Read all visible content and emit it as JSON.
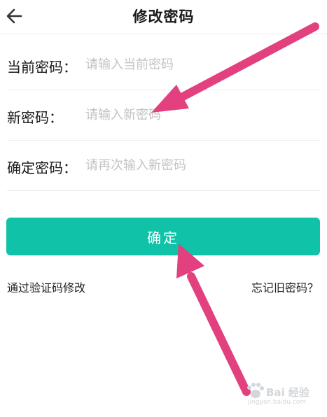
{
  "header": {
    "title": "修改密码",
    "back_icon": "back-arrow-icon"
  },
  "form": {
    "current_password": {
      "label": "当前密码：",
      "placeholder": "请输入当前密码",
      "value": ""
    },
    "new_password": {
      "label": "新密码：",
      "placeholder": "请输入新密码",
      "value": ""
    },
    "confirm_password": {
      "label": "确定密码：",
      "placeholder": "请再次输入新密码",
      "value": ""
    }
  },
  "actions": {
    "confirm_label": "确定",
    "verify_code_link": "通过验证码修改",
    "forgot_link": "忘记旧密码？"
  },
  "watermark": {
    "brand": "Bai 经验",
    "sub": "jingyan.baidu.com"
  },
  "colors": {
    "accent": "#10c2a8",
    "annotation_arrow": "#e2407f"
  }
}
